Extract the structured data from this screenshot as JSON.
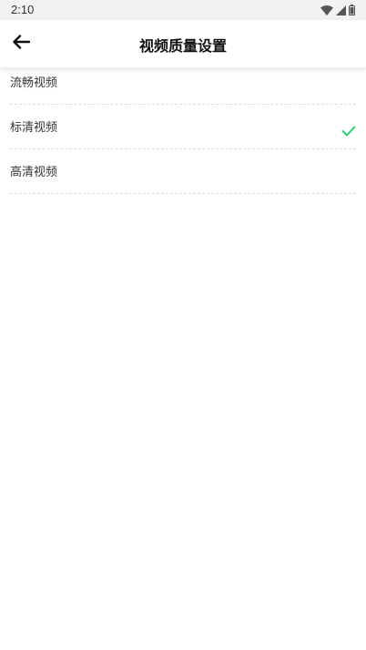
{
  "status_bar": {
    "time": "2:10",
    "icons": [
      "wifi-icon",
      "cellular-signal-icon",
      "battery-icon"
    ]
  },
  "header": {
    "back_icon": "arrow-left-icon",
    "title": "视频质量设置"
  },
  "options": [
    {
      "label": "流畅视频",
      "selected": false
    },
    {
      "label": "标清视频",
      "selected": true
    },
    {
      "label": "高清视频",
      "selected": false
    }
  ],
  "colors": {
    "check_accent": "#2ecc71",
    "status_bar_bg": "#f2f2f2",
    "divider": "#dcdcdc"
  }
}
